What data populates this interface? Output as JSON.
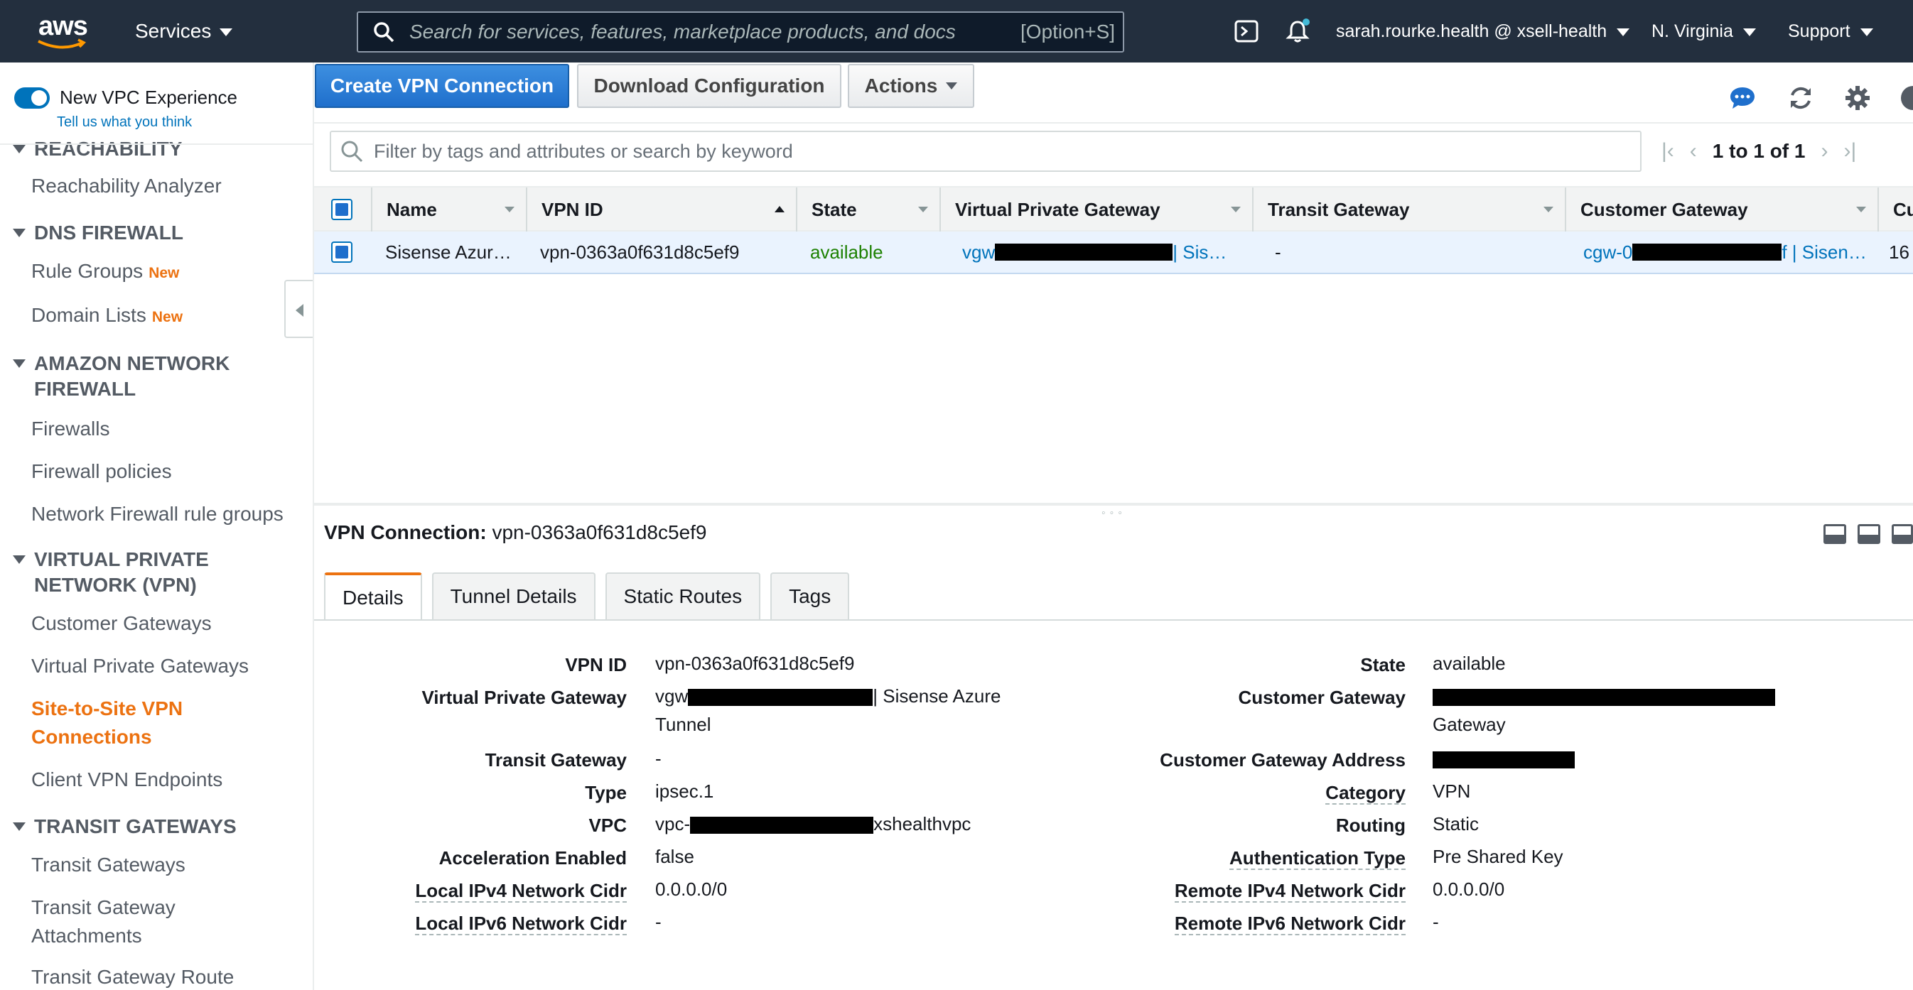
{
  "topnav": {
    "logo_text": "aws",
    "services_label": "Services",
    "search_placeholder": "Search for services, features, marketplace products, and docs",
    "search_shortcut": "[Option+S]",
    "account_label": "sarah.rourke.health @ xsell-health",
    "region_label": "N. Virginia",
    "support_label": "Support"
  },
  "sidebar": {
    "toggle_label": "New VPC Experience",
    "feedback_link": "Tell us what you think",
    "sections": [
      {
        "title": "REACHABILITY",
        "items": [
          {
            "label": "Reachability Analyzer"
          }
        ]
      },
      {
        "title": "DNS FIREWALL",
        "items": [
          {
            "label": "Rule Groups",
            "badge": "New"
          },
          {
            "label": "Domain Lists",
            "badge": "New"
          }
        ]
      },
      {
        "title_lines": [
          "AMAZON NETWORK",
          "FIREWALL"
        ],
        "items": [
          {
            "label": "Firewalls"
          },
          {
            "label": "Firewall policies"
          },
          {
            "label": "Network Firewall rule groups"
          }
        ]
      },
      {
        "title_lines": [
          "VIRTUAL PRIVATE",
          "NETWORK (VPN)"
        ],
        "items": [
          {
            "label": "Customer Gateways"
          },
          {
            "label": "Virtual Private Gateways"
          },
          {
            "label_lines": [
              "Site-to-Site VPN",
              "Connections"
            ],
            "active": true
          },
          {
            "label": "Client VPN Endpoints"
          }
        ]
      },
      {
        "title": "TRANSIT GATEWAYS",
        "items": [
          {
            "label": "Transit Gateways"
          },
          {
            "label_lines": [
              "Transit Gateway",
              "Attachments"
            ]
          },
          {
            "label": "Transit Gateway Route"
          }
        ]
      }
    ]
  },
  "toolbar": {
    "create_label": "Create VPN Connection",
    "download_label": "Download Configuration",
    "actions_label": "Actions"
  },
  "filter": {
    "placeholder": "Filter by tags and attributes or search by keyword"
  },
  "pagination": {
    "text": "1 to 1 of 1"
  },
  "table": {
    "columns": [
      "Name",
      "VPN ID",
      "State",
      "Virtual Private Gateway",
      "Transit Gateway",
      "Customer Gateway",
      "Cu"
    ],
    "rows": [
      {
        "name": "Sisense Azur…",
        "vpn_id": "vpn-0363a0f631d8c5ef9",
        "state": "available",
        "vpg_prefix": "vgw",
        "vpg_suffix": " | Sis…",
        "transit_gateway": "-",
        "cgw_prefix": "cgw-0",
        "cgw_suffix": "f | Sisen…",
        "cu": "16"
      }
    ]
  },
  "detail": {
    "title_label": "VPN Connection:",
    "title_value": "vpn-0363a0f631d8c5ef9",
    "tabs": [
      "Details",
      "Tunnel Details",
      "Static Routes",
      "Tags"
    ],
    "left": {
      "vpn_id_label": "VPN ID",
      "vpn_id_value": "vpn-0363a0f631d8c5ef9",
      "vpg_label": "Virtual Private Gateway",
      "vpg_prefix": "vgw",
      "vpg_suffix": "| Sisense Azure",
      "vpg_line2": "Tunnel",
      "transit_label": "Transit Gateway",
      "transit_value": "-",
      "type_label": "Type",
      "type_value": "ipsec.1",
      "vpc_label": "VPC",
      "vpc_prefix": "vpc-",
      "vpc_suffix": "xshealthvpc",
      "accel_label": "Acceleration Enabled",
      "accel_value": "false",
      "local_v4_label": "Local IPv4 Network Cidr",
      "local_v4_value": "0.0.0.0/0",
      "local_v6_label": "Local IPv6 Network Cidr",
      "local_v6_value": "-"
    },
    "right": {
      "state_label": "State",
      "state_value": "available",
      "cgw_label": "Customer Gateway",
      "cgw_line2": "Gateway",
      "cgw_addr_label": "Customer Gateway Address",
      "category_label": "Category",
      "category_value": "VPN",
      "routing_label": "Routing",
      "routing_value": "Static",
      "auth_label": "Authentication Type",
      "auth_value": "Pre Shared Key",
      "remote_v4_label": "Remote IPv4 Network Cidr",
      "remote_v4_value": "0.0.0.0/0",
      "remote_v6_label": "Remote IPv6 Network Cidr",
      "remote_v6_value": "-"
    }
  },
  "colors": {
    "nav_bg": "#232f3e",
    "primary": "#1f6fcc",
    "link": "#0073bb",
    "active_nav": "#ec7211",
    "success": "#1d8102"
  },
  "icons": [
    "search-icon",
    "cloudshell-icon",
    "bell-icon",
    "chat-icon",
    "refresh-icon",
    "gear-icon",
    "help-icon",
    "filter-search-icon",
    "collapse-arrow-icon"
  ]
}
